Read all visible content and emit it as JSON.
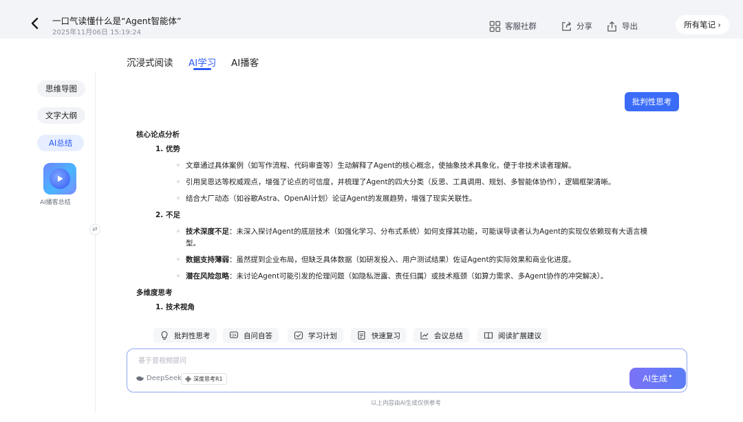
{
  "header": {
    "title": "一口气读懂什么是“Agent智能体”",
    "date": "2025年11月06日 15:19:24",
    "actions": {
      "service_group": "客服社群",
      "share": "分享",
      "export": "导出"
    },
    "all_notes": "所有笔记"
  },
  "sidebar": {
    "mind_map": "思维导图",
    "outline": "文字大纲",
    "ai_summary": "AI总结",
    "podcast_summary": "AI播客总结"
  },
  "tabs": [
    "沉浸式阅读",
    "AI学习",
    "AI播客"
  ],
  "critical_thinking_button": "批判性思考",
  "content": {
    "heading1": "核心论点分析",
    "sub1": "1. 优势",
    "advantages": [
      "文章通过具体案例（如写作流程、代码审查等）生动解释了Agent的核心概念，使抽象技术具象化，便于非技术读者理解。",
      "引用吴恩达等权威观点，增强了论点的可信度，并梳理了Agent的四大分类（反思、工具调用、规划、多智能体协作），逻辑框架清晰。",
      "结合大厂动态（如谷歌Astra、OpenAI计划）论证Agent的发展趋势，增强了现实关联性。"
    ],
    "sub2": "2. 不足",
    "weaknesses": [
      {
        "label": "技术深度不足",
        "text": "：未深入探讨Agent的底层技术（如强化学习、分布式系统）如何支撑其功能，可能误导读者认为Agent的实现仅依赖现有大语言模型。"
      },
      {
        "label": "数据支持薄弱",
        "text": "：虽然提到企业布局，但缺乏具体数据（如研发投入、用户测试结果）佐证Agent的实际效果和商业化进度。"
      },
      {
        "label": "潜在风险忽略",
        "text": "：未讨论Agent可能引发的伦理问题（如隐私泄露、责任归属）或技术瓶颈（如算力需求、多Agent协作的冲突解决）。"
      }
    ],
    "heading2": "多维度思考",
    "sub3": "1. 技术视角"
  },
  "tools": [
    "批判性思考",
    "自问自答",
    "学习计划",
    "快速复习",
    "会议总结",
    "阅读扩展建议"
  ],
  "input": {
    "placeholder": "基于音视频提问",
    "model": "DeepSeek",
    "deep_thinking": "深度思考R1",
    "generate": "AI生成"
  },
  "disclaimer": "以上内容由AI生成仅供参考",
  "colors": {
    "accent": "#2d5cf6",
    "button_blue": "#3b6cf7",
    "gradient_start": "#7b72f7",
    "gradient_end": "#5b7df6"
  }
}
